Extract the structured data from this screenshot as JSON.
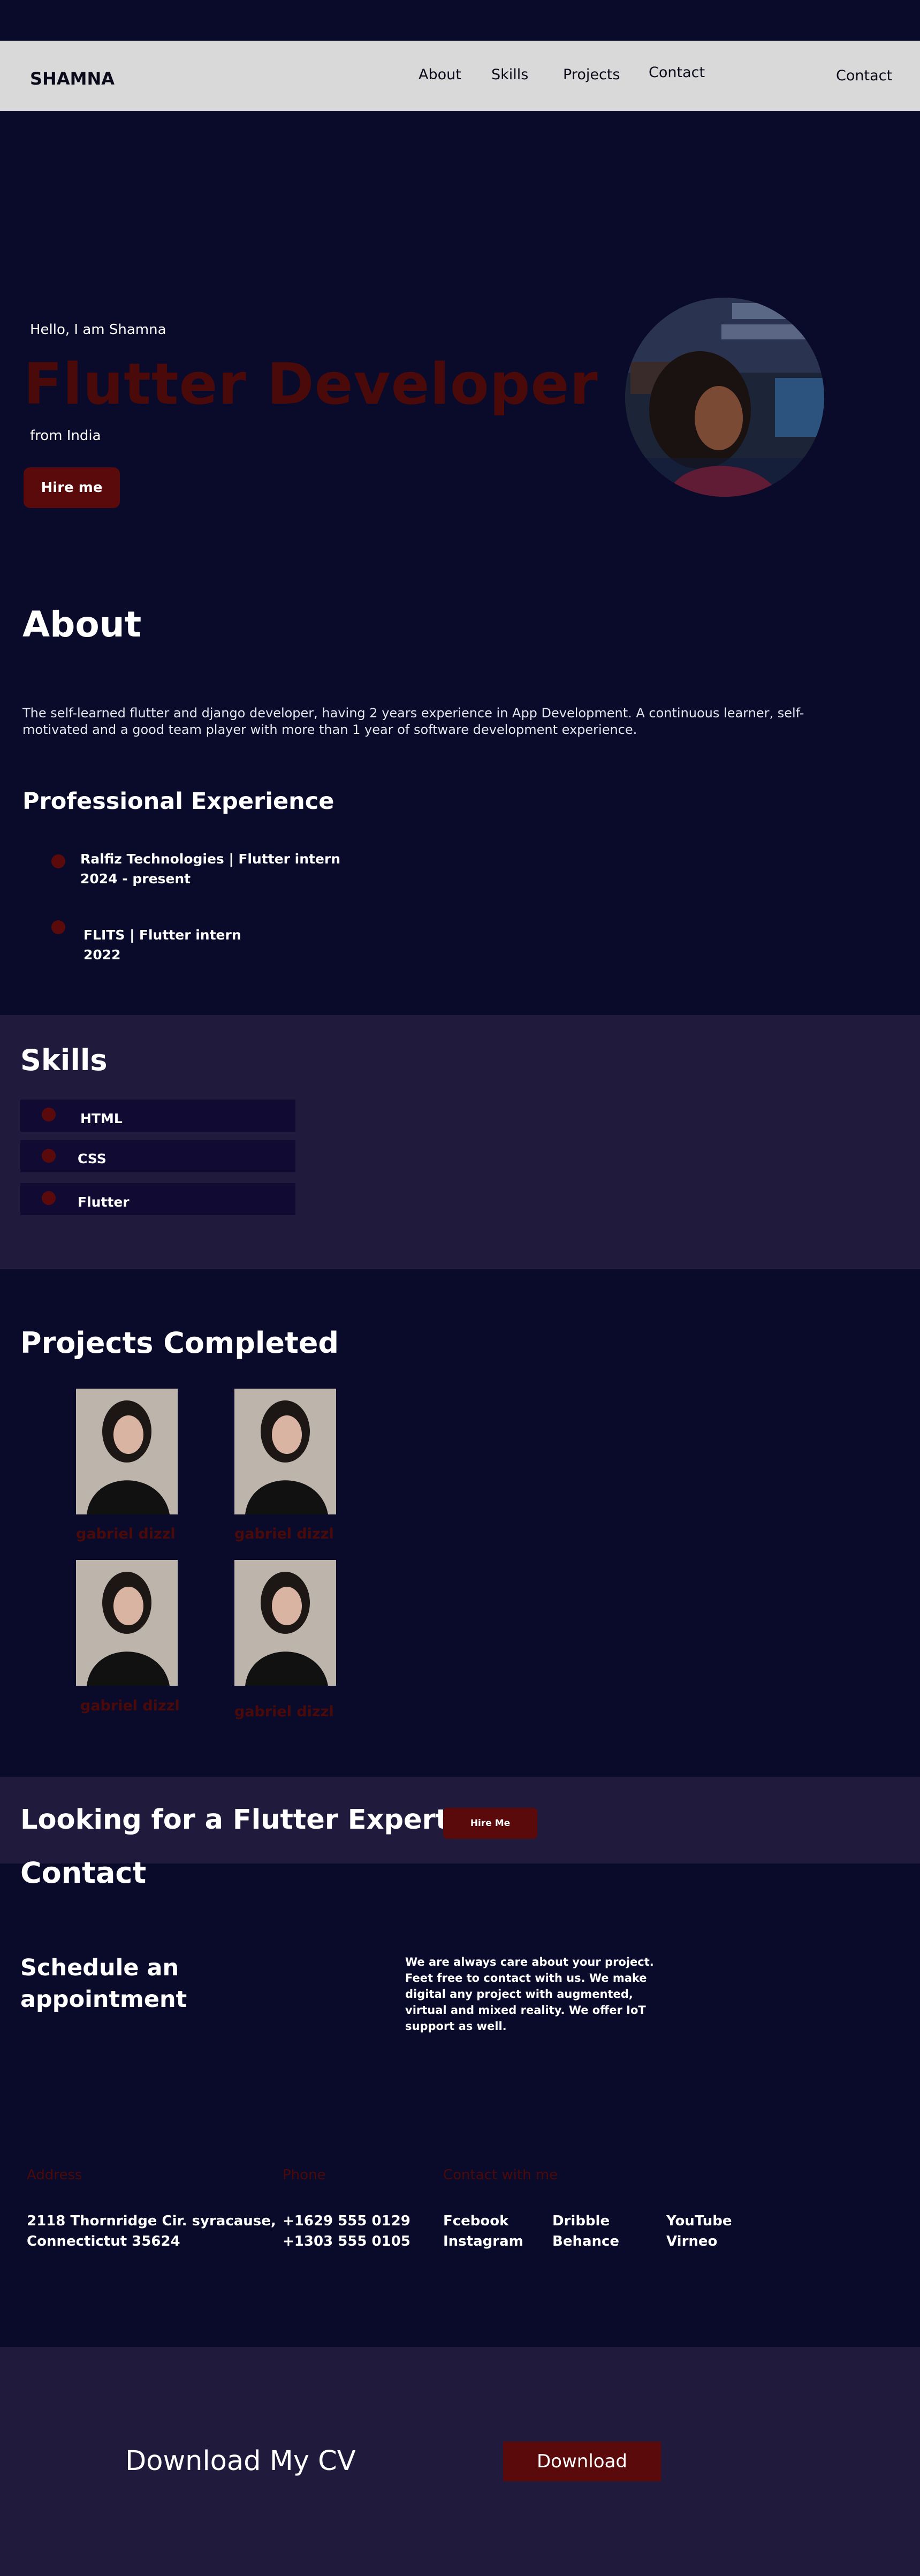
{
  "nav": {
    "brand": "SHAMNA",
    "links": [
      "About",
      "Skills",
      "Projects",
      "Contact"
    ],
    "contact": "Contact"
  },
  "hero": {
    "hello": "Hello,  I am Shamna",
    "title": "Flutter Developer",
    "from": "from India",
    "hire_label": "Hire me"
  },
  "about": {
    "title": "About",
    "text": "The self-learned flutter and django developer, having 2 years experience in App Development. A continuous learner, self-motivated and a good team player with more than 1 year of software development experience."
  },
  "experience": {
    "title": "Professional Experience",
    "items": [
      {
        "role": "Ralfiz Technologies  | Flutter intern",
        "period": "2024 - present"
      },
      {
        "role": "FLITS | Flutter intern",
        "period": "2022"
      }
    ]
  },
  "skills": {
    "title": "Skills",
    "items": [
      "HTML",
      "CSS",
      "Flutter"
    ]
  },
  "projects": {
    "title": "Projects Completed",
    "items": [
      {
        "label": "gabriel dizzl"
      },
      {
        "label": "gabriel dizzl"
      },
      {
        "label": "gabriel dizzl"
      },
      {
        "label": "gabriel dizzl"
      }
    ]
  },
  "expert": {
    "title": "Looking for a Flutter Expert",
    "button": "Hire Me"
  },
  "contact": {
    "title": "Contact",
    "schedule": "Schedule an appointment",
    "blurb": "We are always care about your project. Feet free to contact with us. We make digital any project with augmented, virtual and mixed reality. We offer IoT support as well.",
    "address_head": "Address",
    "address_lines": [
      "2118 Thornridge Cir. syracause,",
      "Connectictut 35624"
    ],
    "phone_head": "Phone",
    "phone_lines": [
      "+1629 555 0129",
      "+1303 555 0105"
    ],
    "social_head": "Contact with me",
    "social": [
      "Fcebook",
      "Instagram",
      "Dribble",
      "Behance",
      "YouTube",
      "Virneo"
    ]
  },
  "download": {
    "title": "Download My CV",
    "button": "Download"
  },
  "colors": {
    "background": "#0a0a2a",
    "section_alt": "#201b3c",
    "accent": "#5a0a0a",
    "nav_bg": "#d9d9d9"
  }
}
